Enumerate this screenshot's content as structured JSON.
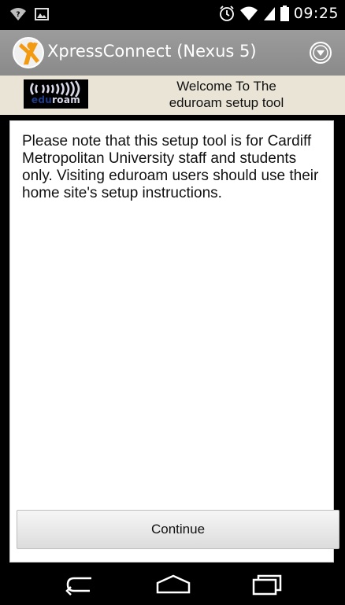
{
  "status_bar": {
    "time": "09:25",
    "icons": [
      "wifi-question-icon",
      "image-notification-icon",
      "alarm-icon",
      "wifi-icon",
      "signal-icon",
      "battery-icon"
    ]
  },
  "action_bar": {
    "title": "XpressConnect  (Nexus 5)",
    "icons": [
      "xpressconnect-logo-icon",
      "overflow-menu-icon"
    ]
  },
  "header": {
    "logo": "eduroam",
    "welcome_line1": "Welcome To The",
    "welcome_line2": "eduroam setup tool"
  },
  "content": {
    "notice": "Please note that this setup tool is for Cardiff Metropolitan University staff and students only. Visiting eduroam users should use their home site's setup instructions.",
    "continue_label": "Continue"
  },
  "nav_bar": {
    "icons": [
      "back-icon",
      "home-icon",
      "recent-apps-icon"
    ]
  },
  "colors": {
    "action_bar": "#939393",
    "header_strip": "#e9e4d6",
    "panel": "#ffffff"
  }
}
